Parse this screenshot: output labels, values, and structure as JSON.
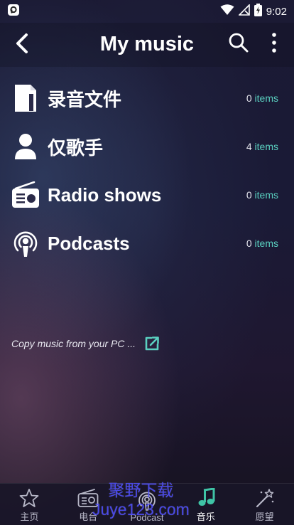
{
  "status_bar": {
    "time": "9:02"
  },
  "header": {
    "title": "My music"
  },
  "list": [
    {
      "label": "录音文件",
      "count": "0",
      "unit": "items",
      "icon": "document-icon"
    },
    {
      "label": "仅歌手",
      "count": "4",
      "unit": "items",
      "icon": "person-icon"
    },
    {
      "label": "Radio shows",
      "count": "0",
      "unit": "items",
      "icon": "radio-icon"
    },
    {
      "label": "Podcasts",
      "count": "0",
      "unit": "items",
      "icon": "podcast-icon"
    }
  ],
  "copy_link": {
    "text": "Copy music from your PC ..."
  },
  "tabs": [
    {
      "label": "主页",
      "icon": "star-icon"
    },
    {
      "label": "电台",
      "icon": "radio-icon"
    },
    {
      "label": "Podcast",
      "icon": "podcast-icon"
    },
    {
      "label": "音乐",
      "icon": "music-note-icon"
    },
    {
      "label": "愿望",
      "icon": "magic-wand-icon"
    }
  ],
  "watermark": {
    "line1": "聚野下载",
    "line2": "Juye123.com"
  },
  "colors": {
    "accent": "#5ad0c0",
    "active_tab": "#3fc4a6",
    "watermark": "#4646ff"
  }
}
